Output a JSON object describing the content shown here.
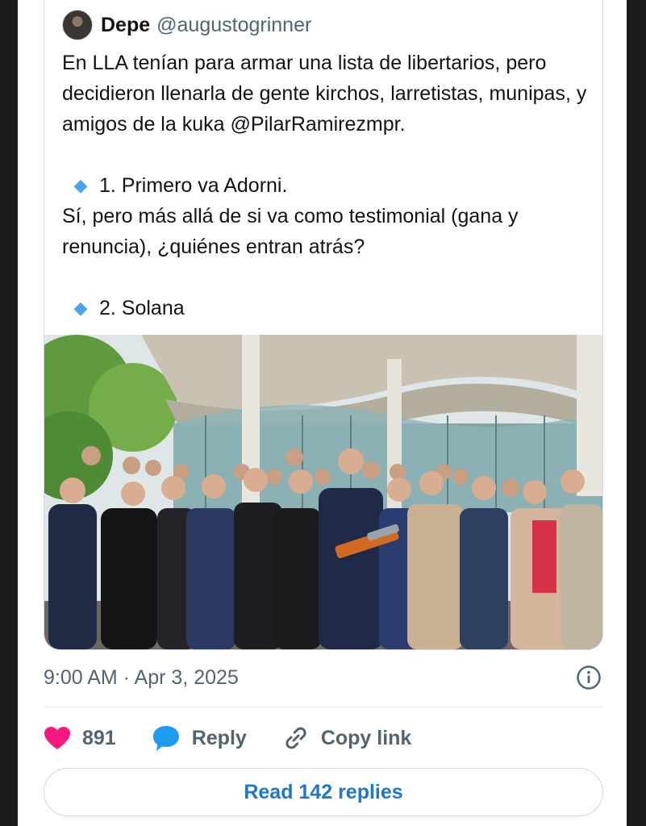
{
  "quoted_tweet": {
    "display_name": "Depe",
    "handle": "@augustogrinner",
    "text_paragraph_1": "En LLA tenían para armar una lista de libertarios, pero decidieron llenarla de gente kirchos, larretistas, munipas, y amigos de la kuka @PilarRamirezmpr.",
    "item_1": "1. Primero va Adorni.",
    "text_paragraph_2": "Sí, pero más allá de si va como testimonial (gana y renuncia), ¿quiénes entran atrás?",
    "item_2": "2. Solana"
  },
  "timestamp": "9:00 AM · Apr 3, 2025",
  "actions": {
    "like_count": "891",
    "reply_label": "Reply",
    "copy_link_label": "Copy link"
  },
  "read_replies_label": "Read 142 replies",
  "colors": {
    "like": "#f91880",
    "reply": "#1d9bf0",
    "link_text": "#1d78c7",
    "bullet": "#4aa3ed"
  },
  "icons": [
    "heart-icon",
    "reply-bubble-icon",
    "link-icon",
    "info-icon",
    "blue-diamond-icon"
  ]
}
